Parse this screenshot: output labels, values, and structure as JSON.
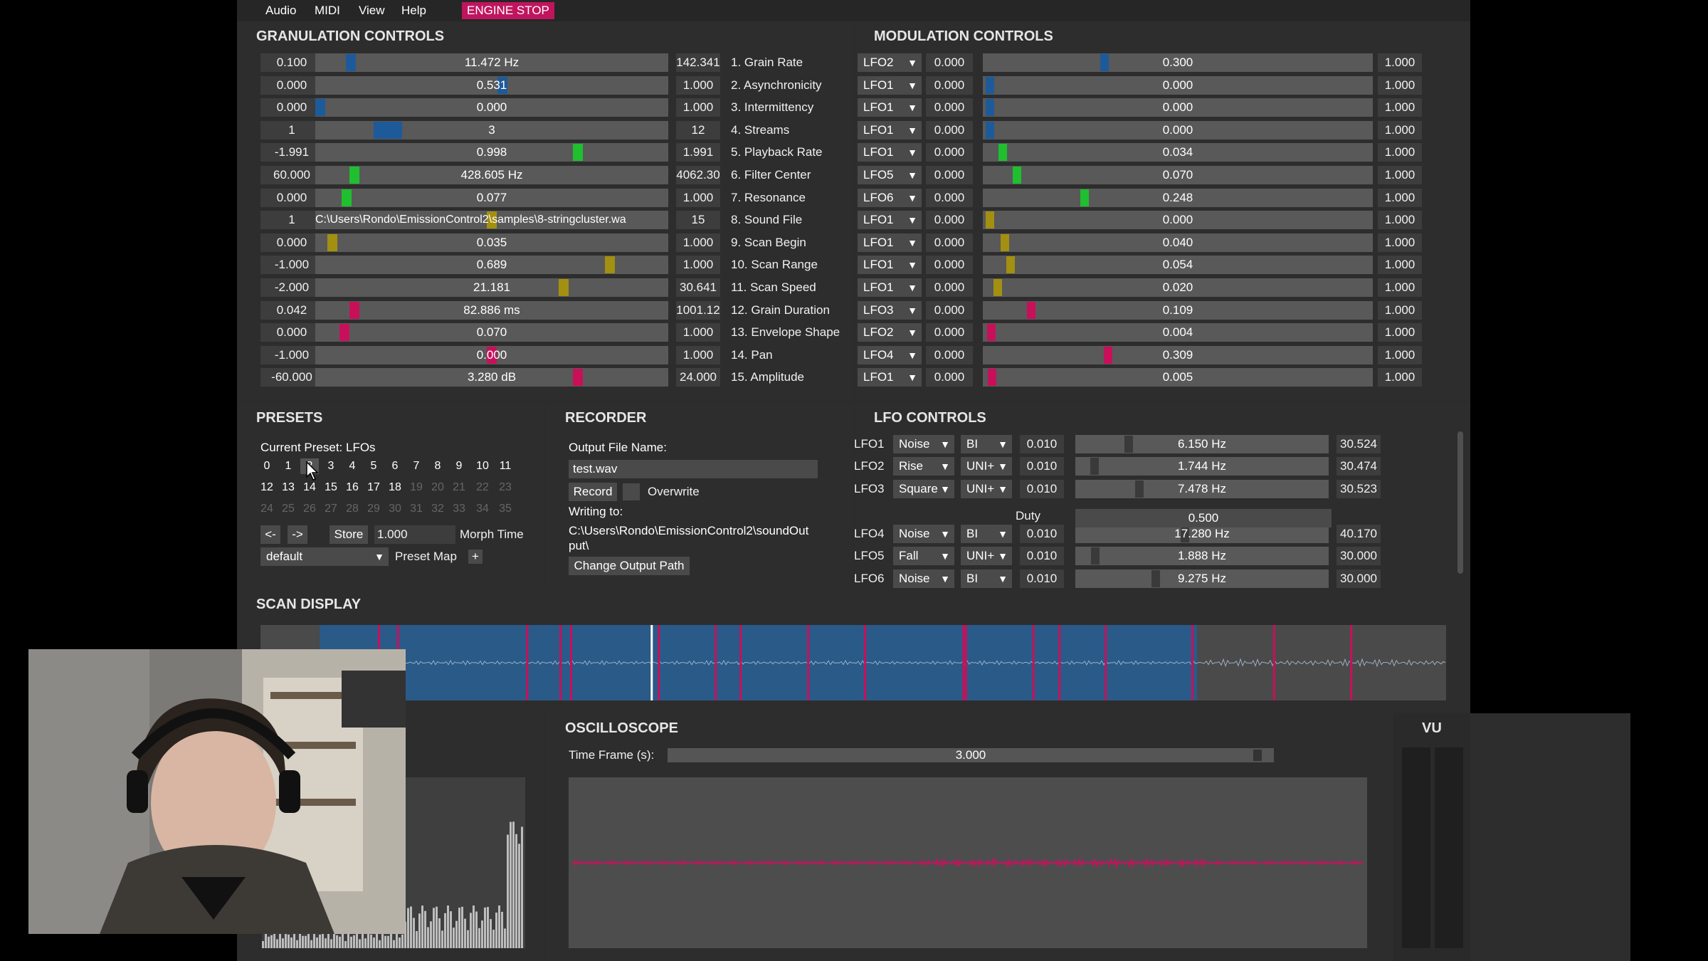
{
  "menu": {
    "items": [
      "Audio",
      "MIDI",
      "View",
      "Help"
    ],
    "engine_button": "ENGINE STOP"
  },
  "colors": {
    "blue": "#1d5a9a",
    "green": "#1fbf2f",
    "olive": "#a38f10",
    "magenta": "#c8105a",
    "engine": "#c0155e"
  },
  "granulation": {
    "title": "GRANULATION CONTROLS",
    "rows": [
      {
        "min": "0.100",
        "value": "11.472 Hz",
        "max": "142.341",
        "label": "1. Grain Rate",
        "level": 0.09,
        "color": "blue"
      },
      {
        "min": "0.000",
        "value": "0.531",
        "max": "1.000",
        "label": "2. Asynchronicity",
        "level": 0.531,
        "color": "blue"
      },
      {
        "min": "0.000",
        "value": "0.000",
        "max": "1.000",
        "label": "3. Intermittency",
        "level": 0.0,
        "color": "blue"
      },
      {
        "min": "1",
        "value": "3",
        "max": "12",
        "label": "4. Streams",
        "level": 0.18,
        "color": "blue"
      },
      {
        "min": "-1.991",
        "value": "0.998",
        "max": "1.991",
        "label": "5. Playback Rate",
        "level": 0.75,
        "color": "green"
      },
      {
        "min": "60.000",
        "value": "428.605 Hz",
        "max": "4062.30",
        "label": "6. Filter Center",
        "level": 0.1,
        "color": "green"
      },
      {
        "min": "0.000",
        "value": "0.077",
        "max": "1.000",
        "label": "7. Resonance",
        "level": 0.077,
        "color": "green"
      },
      {
        "min": "1",
        "value": "C:\\Users\\Rondo\\EmissionControl2\\samples\\8-stringcluster.wa",
        "max": "15",
        "label": "8. Sound File",
        "level": 0.5,
        "color": "olive"
      },
      {
        "min": "0.000",
        "value": "0.035",
        "max": "1.000",
        "label": "9. Scan Begin",
        "level": 0.035,
        "color": "olive"
      },
      {
        "min": "-1.000",
        "value": "0.689",
        "max": "1.000",
        "label": "10. Scan Range",
        "level": 0.845,
        "color": "olive"
      },
      {
        "min": "-2.000",
        "value": "21.181",
        "max": "30.641",
        "label": "11. Scan Speed",
        "level": 0.71,
        "color": "olive"
      },
      {
        "min": "0.042",
        "value": "82.886 ms",
        "max": "1001.12",
        "label": "12. Grain Duration",
        "level": 0.1,
        "color": "magenta"
      },
      {
        "min": "0.000",
        "value": "0.070",
        "max": "1.000",
        "label": "13. Envelope Shape",
        "level": 0.07,
        "color": "magenta"
      },
      {
        "min": "-1.000",
        "value": "0.000",
        "max": "1.000",
        "label": "14. Pan",
        "level": 0.5,
        "color": "magenta"
      },
      {
        "min": "-60.000",
        "value": "3.280 dB",
        "max": "24.000",
        "label": "15. Amplitude",
        "level": 0.75,
        "color": "magenta"
      }
    ]
  },
  "modulation": {
    "title": "MODULATION CONTROLS",
    "rows": [
      {
        "lfo": "LFO2",
        "min": "0.000",
        "value": "0.300",
        "max": "1.000",
        "level": 0.3,
        "color": "blue"
      },
      {
        "lfo": "LFO1",
        "min": "0.000",
        "value": "0.000",
        "max": "1.000",
        "level": 0.0,
        "color": "blue"
      },
      {
        "lfo": "LFO1",
        "min": "0.000",
        "value": "0.000",
        "max": "1.000",
        "level": 0.0,
        "color": "blue"
      },
      {
        "lfo": "LFO1",
        "min": "0.000",
        "value": "0.000",
        "max": "1.000",
        "level": 0.0,
        "color": "blue"
      },
      {
        "lfo": "LFO1",
        "min": "0.000",
        "value": "0.034",
        "max": "1.000",
        "level": 0.034,
        "color": "green"
      },
      {
        "lfo": "LFO5",
        "min": "0.000",
        "value": "0.070",
        "max": "1.000",
        "level": 0.07,
        "color": "green"
      },
      {
        "lfo": "LFO6",
        "min": "0.000",
        "value": "0.248",
        "max": "1.000",
        "level": 0.248,
        "color": "green"
      },
      {
        "lfo": "LFO1",
        "min": "0.000",
        "value": "0.000",
        "max": "1.000",
        "level": 0.0,
        "color": "olive"
      },
      {
        "lfo": "LFO1",
        "min": "0.000",
        "value": "0.040",
        "max": "1.000",
        "level": 0.04,
        "color": "olive"
      },
      {
        "lfo": "LFO1",
        "min": "0.000",
        "value": "0.054",
        "max": "1.000",
        "level": 0.054,
        "color": "olive"
      },
      {
        "lfo": "LFO1",
        "min": "0.000",
        "value": "0.020",
        "max": "1.000",
        "level": 0.02,
        "color": "olive"
      },
      {
        "lfo": "LFO3",
        "min": "0.000",
        "value": "0.109",
        "max": "1.000",
        "level": 0.109,
        "color": "magenta"
      },
      {
        "lfo": "LFO2",
        "min": "0.000",
        "value": "0.004",
        "max": "1.000",
        "level": 0.004,
        "color": "magenta"
      },
      {
        "lfo": "LFO4",
        "min": "0.000",
        "value": "0.309",
        "max": "1.000",
        "level": 0.309,
        "color": "magenta"
      },
      {
        "lfo": "LFO1",
        "min": "0.000",
        "value": "0.005",
        "max": "1.000",
        "level": 0.005,
        "color": "magenta"
      }
    ]
  },
  "presets": {
    "title": "PRESETS",
    "current": "Current Preset: LFOs",
    "row1": [
      "0",
      "1",
      "2",
      "3",
      "4",
      "5",
      "6",
      "7",
      "8",
      "9",
      "10",
      "11"
    ],
    "row2": [
      "12",
      "13",
      "14",
      "15",
      "16",
      "17",
      "18",
      "19",
      "20",
      "21",
      "22",
      "23"
    ],
    "row3": [
      "24",
      "25",
      "26",
      "27",
      "28",
      "29",
      "30",
      "31",
      "32",
      "33",
      "34",
      "35"
    ],
    "prev": "<-",
    "next": "->",
    "store": "Store",
    "morph_value": "1.000",
    "morph_label": "Morph Time",
    "map_select": "default",
    "map_label": "Preset Map",
    "plus": "+"
  },
  "recorder": {
    "title": "RECORDER",
    "file_label": "Output File Name:",
    "file_value": "test.wav",
    "record": "Record",
    "overwrite": "Overwrite",
    "writing_label": "Writing to:",
    "path_line1": "C:\\Users\\Rondo\\EmissionControl2\\soundOut",
    "path_line2": "put\\",
    "change_path": "Change Output Path"
  },
  "lfo": {
    "title": "LFO CONTROLS",
    "duty_label": "Duty",
    "duty_value": "0.500",
    "rows": [
      {
        "name": "LFO1",
        "shape": "Noise",
        "polarity": "BI",
        "min": "0.010",
        "value": "6.150 Hz",
        "max": "30.524",
        "level": 0.2
      },
      {
        "name": "LFO2",
        "shape": "Rise",
        "polarity": "UNI+",
        "min": "0.010",
        "value": "1.744 Hz",
        "max": "30.474",
        "level": 0.06
      },
      {
        "name": "LFO3",
        "shape": "Square",
        "polarity": "UNI+",
        "min": "0.010",
        "value": "7.478 Hz",
        "max": "30.523",
        "level": 0.245
      },
      {
        "name": "LFO4",
        "shape": "Noise",
        "polarity": "BI",
        "min": "0.010",
        "value": "17.280 Hz",
        "max": "40.170",
        "level": 0.43
      },
      {
        "name": "LFO5",
        "shape": "Fall",
        "polarity": "UNI+",
        "min": "0.010",
        "value": "1.888 Hz",
        "max": "30.000",
        "level": 0.063
      },
      {
        "name": "LFO6",
        "shape": "Noise",
        "polarity": "BI",
        "min": "0.010",
        "value": "9.275 Hz",
        "max": "30.000",
        "level": 0.31
      }
    ]
  },
  "scan": {
    "title": "SCAN DISPLAY",
    "region_start": 0.05,
    "region_end": 0.79,
    "playhead": 0.33
  },
  "oscilloscope": {
    "title": "OSCILLOSCOPE",
    "time_label": "Time Frame (s):",
    "time_value": "3.000",
    "time_level": 0.98
  },
  "vu": {
    "title": "VU"
  }
}
